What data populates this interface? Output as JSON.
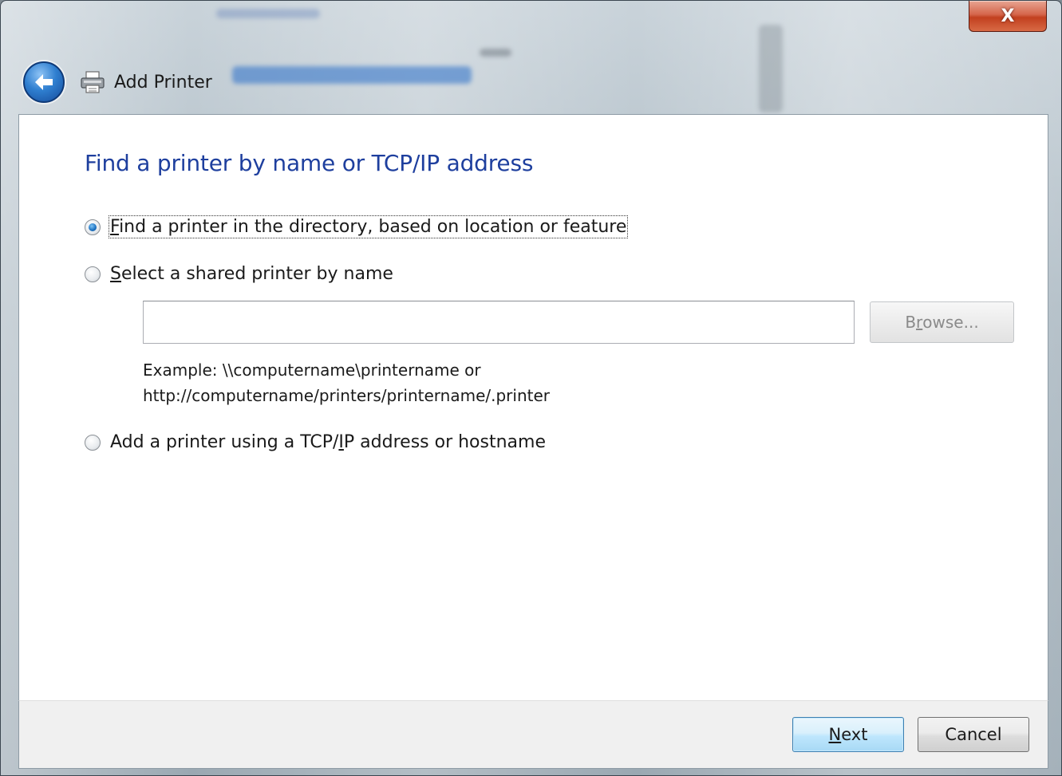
{
  "window": {
    "title": "Add Printer",
    "close_label": "X"
  },
  "page": {
    "heading": "Find a printer by name or TCP/IP address"
  },
  "options": [
    {
      "label_mnemonic": "F",
      "label_rest": "ind a printer in the directory, based on location or feature",
      "selected": true
    },
    {
      "label_mnemonic": "S",
      "label_rest": "elect a shared printer by name",
      "selected": false
    },
    {
      "label_before": "Add a printer using a TCP/",
      "label_mnemonic": "I",
      "label_after": "P address or hostname",
      "selected": false
    }
  ],
  "shared_printer": {
    "input_value": "",
    "browse_before": "B",
    "browse_mnemonic": "r",
    "browse_after": "owse...",
    "example_line1": "Example: \\\\computername\\printername or",
    "example_line2": "http://computername/printers/printername/.printer"
  },
  "footer": {
    "next_mnemonic": "N",
    "next_rest": "ext",
    "cancel_label": "Cancel"
  },
  "colors": {
    "heading": "#1e3f9e",
    "close_red": "#c2401f",
    "back_blue": "#2f7fd0"
  }
}
